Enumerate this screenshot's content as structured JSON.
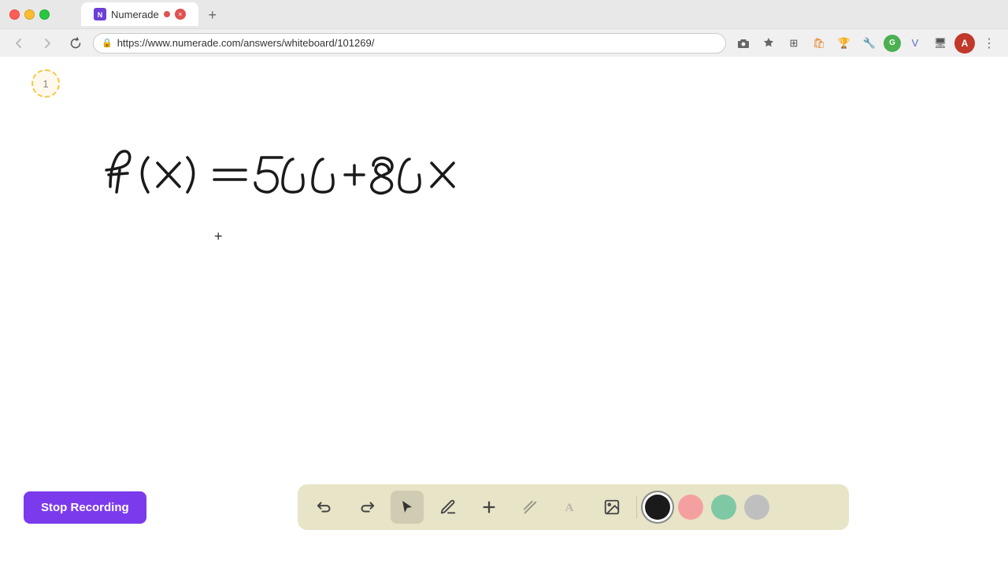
{
  "browser": {
    "title": "Numerade",
    "url": "https://www.numerade.com/answers/whiteboard/101269/",
    "tab_close": "×",
    "new_tab": "+",
    "profile_letter": "A"
  },
  "page_indicator": "1",
  "formula": "f(x) = 500 + 80x",
  "cursor_symbol": "+",
  "toolbar": {
    "stop_recording": "Stop Recording",
    "tools": [
      {
        "name": "undo",
        "symbol": "↺",
        "label": "Undo"
      },
      {
        "name": "redo",
        "symbol": "↻",
        "label": "Redo"
      },
      {
        "name": "select",
        "symbol": "▲",
        "label": "Select"
      },
      {
        "name": "pen",
        "symbol": "✏",
        "label": "Pen"
      },
      {
        "name": "add",
        "symbol": "+",
        "label": "Add"
      },
      {
        "name": "eraser",
        "symbol": "/",
        "label": "Eraser"
      },
      {
        "name": "text",
        "symbol": "A",
        "label": "Text"
      },
      {
        "name": "image",
        "symbol": "🖼",
        "label": "Image"
      }
    ],
    "colors": [
      {
        "name": "black",
        "hex": "#1a1a1a"
      },
      {
        "name": "pink",
        "hex": "#f4a0a0"
      },
      {
        "name": "green",
        "hex": "#7fc8a4"
      },
      {
        "name": "gray",
        "hex": "#c0bfbf"
      }
    ]
  },
  "colors": {
    "stop_btn_bg": "#7c3aed",
    "toolbar_bg": "#e8e4c8",
    "recording_dot": "#e05252"
  }
}
